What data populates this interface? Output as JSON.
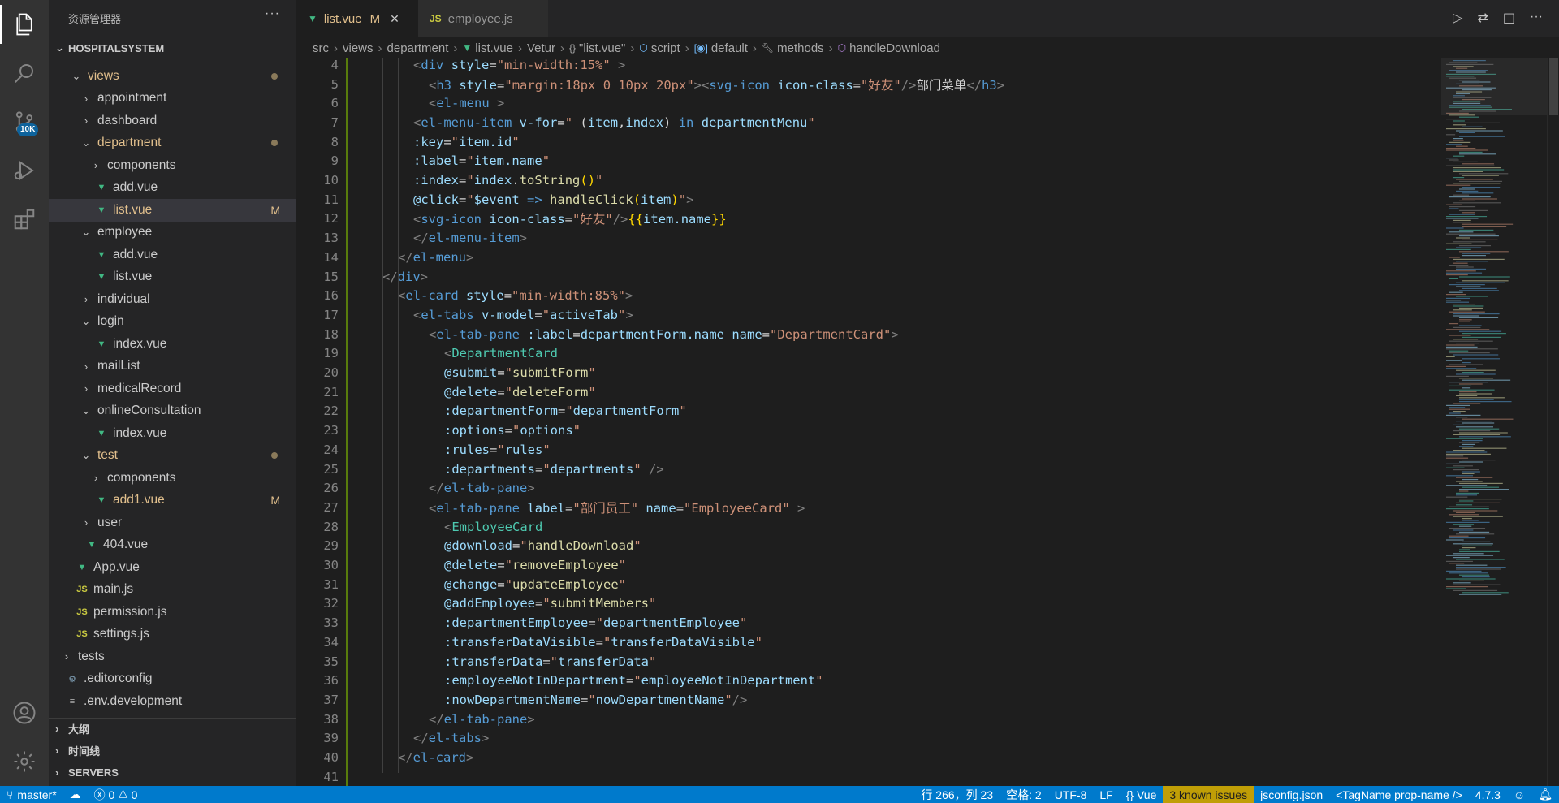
{
  "activity_bar": {
    "badge": "10K",
    "icons": [
      "files-icon",
      "search-icon",
      "source-control-icon",
      "run-debug-icon",
      "extensions-icon",
      "account-icon",
      "settings-gear-icon"
    ]
  },
  "sidebar": {
    "title": "资源管理器",
    "more": "···",
    "root": "HOSPITALSYSTEM",
    "items": [
      {
        "label": "views",
        "kind": "folder-open",
        "depth": 1,
        "dot": true
      },
      {
        "label": "appointment",
        "kind": "folder",
        "depth": 2
      },
      {
        "label": "dashboard",
        "kind": "folder",
        "depth": 2
      },
      {
        "label": "department",
        "kind": "folder-open",
        "depth": 2,
        "dot": true
      },
      {
        "label": "components",
        "kind": "folder",
        "depth": 3
      },
      {
        "label": "add.vue",
        "kind": "vue",
        "depth": 3
      },
      {
        "label": "list.vue",
        "kind": "vue",
        "depth": 3,
        "status": "M",
        "selected": true
      },
      {
        "label": "employee",
        "kind": "folder-open",
        "depth": 2
      },
      {
        "label": "add.vue",
        "kind": "vue",
        "depth": 3
      },
      {
        "label": "list.vue",
        "kind": "vue",
        "depth": 3
      },
      {
        "label": "individual",
        "kind": "folder",
        "depth": 2
      },
      {
        "label": "login",
        "kind": "folder-open",
        "depth": 2
      },
      {
        "label": "index.vue",
        "kind": "vue",
        "depth": 3
      },
      {
        "label": "mailList",
        "kind": "folder",
        "depth": 2
      },
      {
        "label": "medicalRecord",
        "kind": "folder",
        "depth": 2
      },
      {
        "label": "onlineConsultation",
        "kind": "folder-open",
        "depth": 2
      },
      {
        "label": "index.vue",
        "kind": "vue",
        "depth": 3
      },
      {
        "label": "test",
        "kind": "folder-open",
        "depth": 2,
        "dot": true
      },
      {
        "label": "components",
        "kind": "folder",
        "depth": 3
      },
      {
        "label": "add1.vue",
        "kind": "vue",
        "depth": 3,
        "status": "M"
      },
      {
        "label": "user",
        "kind": "folder",
        "depth": 2
      },
      {
        "label": "404.vue",
        "kind": "vue",
        "depth": 2
      },
      {
        "label": "App.vue",
        "kind": "vue",
        "depth": 1
      },
      {
        "label": "main.js",
        "kind": "js",
        "depth": 1
      },
      {
        "label": "permission.js",
        "kind": "js",
        "depth": 1
      },
      {
        "label": "settings.js",
        "kind": "js",
        "depth": 1
      },
      {
        "label": "tests",
        "kind": "folder",
        "depth": 0
      },
      {
        "label": ".editorconfig",
        "kind": "gear",
        "depth": 0
      },
      {
        "label": ".env.development",
        "kind": "lines",
        "depth": 0
      }
    ],
    "sections": [
      "大纲",
      "时间线",
      "SERVERS"
    ]
  },
  "tabs": [
    {
      "label": "list.vue",
      "icon": "vue",
      "modified": "M",
      "active": true
    },
    {
      "label": "employee.js",
      "icon": "js",
      "active": false
    }
  ],
  "breadcrumb": [
    "src",
    "views",
    "department",
    "list.vue",
    "Vetur",
    "\"list.vue\"",
    "script",
    "default",
    "methods",
    "handleDownload"
  ],
  "code_lines": [
    {
      "n": "4",
      "indent": 4,
      "html": "<span class='t-br'>&lt;</span><span class='t-tag'>div</span> <span class='t-attr'>style</span>=<span class='t-str'>\"min-width:15%\"</span> <span class='t-br'>&gt;</span>"
    },
    {
      "n": "5",
      "indent": 5,
      "html": "<span class='t-br'>&lt;</span><span class='t-tag'>h3</span> <span class='t-attr'>style</span>=<span class='t-str'>\"margin:18px 0 10px 20px\"</span><span class='t-br'>&gt;&lt;</span><span class='t-tag'>svg-icon</span> <span class='t-attr'>icon-class</span>=<span class='t-str'>\"好友\"</span><span class='t-br'>/&gt;</span><span class='t-txt'>部门菜单</span><span class='t-br'>&lt;/</span><span class='t-tag'>h3</span><span class='t-br'>&gt;</span>"
    },
    {
      "n": "6",
      "indent": 5,
      "html": "<span class='t-br'>&lt;</span><span class='t-tag'>el-menu</span> <span class='t-br'>&gt;</span>"
    },
    {
      "n": "7",
      "indent": 4,
      "html": "<span class='t-br'>&lt;</span><span class='t-tag'>el-menu-item</span> <span class='t-attr'>v-for</span>=<span class='t-str'>\" </span><span class='t-txt'>(</span><span class='t-attr'>item</span><span class='t-txt'>,</span><span class='t-attr'>index</span><span class='t-txt'>) </span><span class='t-kw'>in</span> <span class='t-attr'>departmentMenu</span><span class='t-str'>\"</span>"
    },
    {
      "n": "8",
      "indent": 4,
      "html": "<span class='t-attr'>:key</span>=<span class='t-str'>\"</span><span class='t-attr'>item.id</span><span class='t-str'>\"</span>"
    },
    {
      "n": "9",
      "indent": 4,
      "html": "<span class='t-attr'>:label</span>=<span class='t-str'>\"</span><span class='t-attr'>item.name</span><span class='t-str'>\"</span>"
    },
    {
      "n": "10",
      "indent": 4,
      "html": "<span class='t-attr'>:index</span>=<span class='t-str'>\"</span><span class='t-attr'>index</span>.<span class='t-fn'>toString</span><span class='t-mus'>()</span><span class='t-str'>\"</span>"
    },
    {
      "n": "11",
      "indent": 4,
      "html": "<span class='t-attr'>@click</span>=<span class='t-str'>\"</span><span class='t-attr'>$event</span> <span class='t-kw'>=&gt;</span> <span class='t-fn'>handleClick</span><span class='t-mus'>(</span><span class='t-attr'>item</span><span class='t-mus'>)</span><span class='t-str'>\"</span><span class='t-br'>&gt;</span>"
    },
    {
      "n": "12",
      "indent": 4,
      "html": "<span class='t-br'>&lt;</span><span class='t-tag'>svg-icon</span> <span class='t-attr'>icon-class</span>=<span class='t-str'>\"好友\"</span><span class='t-br'>/&gt;</span><span class='t-mus'>{{</span><span class='t-attr'>item.name</span><span class='t-mus'>}}</span>"
    },
    {
      "n": "13",
      "indent": 4,
      "html": "<span class='t-br'>&lt;/</span><span class='t-tag'>el-menu-item</span><span class='t-br'>&gt;</span>"
    },
    {
      "n": "14",
      "indent": 3,
      "html": "<span class='t-br'>&lt;/</span><span class='t-tag'>el-menu</span><span class='t-br'>&gt;</span>"
    },
    {
      "n": "15",
      "indent": 2,
      "html": "<span class='t-br'>&lt;/</span><span class='t-tag'>div</span><span class='t-br'>&gt;</span>"
    },
    {
      "n": "16",
      "indent": 3,
      "html": "<span class='t-br'>&lt;</span><span class='t-tag'>el-card</span> <span class='t-attr'>style</span>=<span class='t-str'>\"min-width:85%\"</span><span class='t-br'>&gt;</span>"
    },
    {
      "n": "17",
      "indent": 4,
      "html": "<span class='t-br'>&lt;</span><span class='t-tag'>el-tabs</span> <span class='t-attr'>v-model</span>=<span class='t-str'>\"</span><span class='t-attr'>activeTab</span><span class='t-str'>\"</span><span class='t-br'>&gt;</span>"
    },
    {
      "n": "18",
      "indent": 5,
      "html": "<span class='t-br'>&lt;</span><span class='t-tag'>el-tab-pane</span> <span class='t-attr'>:label</span>=<span class='t-attr'>departmentForm.name</span> <span class='t-attr'>name</span>=<span class='t-str'>\"DepartmentCard\"</span><span class='t-br'>&gt;</span>"
    },
    {
      "n": "19",
      "indent": 6,
      "html": "<span class='t-br'>&lt;</span><span class='t-comp'>DepartmentCard</span>"
    },
    {
      "n": "20",
      "indent": 6,
      "html": "<span class='t-attr'>@submit</span>=<span class='t-str'>\"</span><span class='t-fn'>submitForm</span><span class='t-str'>\"</span>"
    },
    {
      "n": "21",
      "indent": 6,
      "html": "<span class='t-attr'>@delete</span>=<span class='t-str'>\"</span><span class='t-fn'>deleteForm</span><span class='t-str'>\"</span>"
    },
    {
      "n": "22",
      "indent": 6,
      "html": "<span class='t-attr'>:departmentForm</span>=<span class='t-str'>\"</span><span class='t-attr'>departmentForm</span><span class='t-str'>\"</span>"
    },
    {
      "n": "23",
      "indent": 6,
      "html": "<span class='t-attr'>:options</span>=<span class='t-str'>\"</span><span class='t-attr'>options</span><span class='t-str'>\"</span>"
    },
    {
      "n": "24",
      "indent": 6,
      "html": "<span class='t-attr'>:rules</span>=<span class='t-str'>\"</span><span class='t-attr'>rules</span><span class='t-str'>\"</span>"
    },
    {
      "n": "25",
      "indent": 6,
      "html": "<span class='t-attr'>:departments</span>=<span class='t-str'>\"</span><span class='t-attr'>departments</span><span class='t-str'>\"</span> <span class='t-br'>/&gt;</span>"
    },
    {
      "n": "26",
      "indent": 5,
      "html": "<span class='t-br'>&lt;/</span><span class='t-tag'>el-tab-pane</span><span class='t-br'>&gt;</span>"
    },
    {
      "n": "27",
      "indent": 5,
      "html": "<span class='t-br'>&lt;</span><span class='t-tag'>el-tab-pane</span> <span class='t-attr'>label</span>=<span class='t-str'>\"部门员工\"</span> <span class='t-attr'>name</span>=<span class='t-str'>\"EmployeeCard\"</span> <span class='t-br'>&gt;</span>"
    },
    {
      "n": "28",
      "indent": 6,
      "html": "<span class='t-br'>&lt;</span><span class='t-comp'>EmployeeCard</span>"
    },
    {
      "n": "29",
      "indent": 6,
      "html": "<span class='t-attr'>@download</span>=<span class='t-str'>\"</span><span class='t-fn'>handleDownload</span><span class='t-str'>\"</span>"
    },
    {
      "n": "30",
      "indent": 6,
      "html": "<span class='t-attr'>@delete</span>=<span class='t-str'>\"</span><span class='t-fn'>removeEmployee</span><span class='t-str'>\"</span>"
    },
    {
      "n": "31",
      "indent": 6,
      "html": "<span class='t-attr'>@change</span>=<span class='t-str'>\"</span><span class='t-fn'>updateEmployee</span><span class='t-str'>\"</span>"
    },
    {
      "n": "32",
      "indent": 6,
      "html": "<span class='t-attr'>@addEmployee</span>=<span class='t-str'>\"</span><span class='t-fn'>submitMembers</span><span class='t-str'>\"</span>"
    },
    {
      "n": "33",
      "indent": 6,
      "html": "<span class='t-attr'>:departmentEmployee</span>=<span class='t-str'>\"</span><span class='t-attr'>departmentEmployee</span><span class='t-str'>\"</span>"
    },
    {
      "n": "34",
      "indent": 6,
      "html": "<span class='t-attr'>:transferDataVisible</span>=<span class='t-str'>\"</span><span class='t-attr'>transferDataVisible</span><span class='t-str'>\"</span>"
    },
    {
      "n": "35",
      "indent": 6,
      "html": "<span class='t-attr'>:transferData</span>=<span class='t-str'>\"</span><span class='t-attr'>transferData</span><span class='t-str'>\"</span>"
    },
    {
      "n": "36",
      "indent": 6,
      "html": "<span class='t-attr'>:employeeNotInDepartment</span>=<span class='t-str'>\"</span><span class='t-attr'>employeeNotInDepartment</span><span class='t-str'>\"</span>"
    },
    {
      "n": "37",
      "indent": 6,
      "html": "<span class='t-attr'>:nowDepartmentName</span>=<span class='t-str'>\"</span><span class='t-attr'>nowDepartmentName</span><span class='t-str'>\"</span><span class='t-br'>/&gt;</span>"
    },
    {
      "n": "38",
      "indent": 5,
      "html": "<span class='t-br'>&lt;/</span><span class='t-tag'>el-tab-pane</span><span class='t-br'>&gt;</span>"
    },
    {
      "n": "39",
      "indent": 4,
      "html": "<span class='t-br'>&lt;/</span><span class='t-tag'>el-tabs</span><span class='t-br'>&gt;</span>"
    },
    {
      "n": "40",
      "indent": 3,
      "html": "<span class='t-br'>&lt;/</span><span class='t-tag'>el-card</span><span class='t-br'>&gt;</span>"
    },
    {
      "n": "41",
      "indent": 0,
      "html": ""
    }
  ],
  "status": {
    "branch": "master*",
    "errors": "0",
    "warnings": "0",
    "position": "行 266，列 23",
    "spaces": "空格: 2",
    "encoding": "UTF-8",
    "eol": "LF",
    "language": "Vue",
    "issues": "3 known issues",
    "config": "jsconfig.json",
    "tagname": "<TagName prop-name />",
    "version": "4.7.3"
  },
  "colors": {
    "accent": "#007acc",
    "vue": "#41b883",
    "js": "#cbcb41",
    "modified": "#e2c08d",
    "warning_bg": "#c09e06"
  }
}
